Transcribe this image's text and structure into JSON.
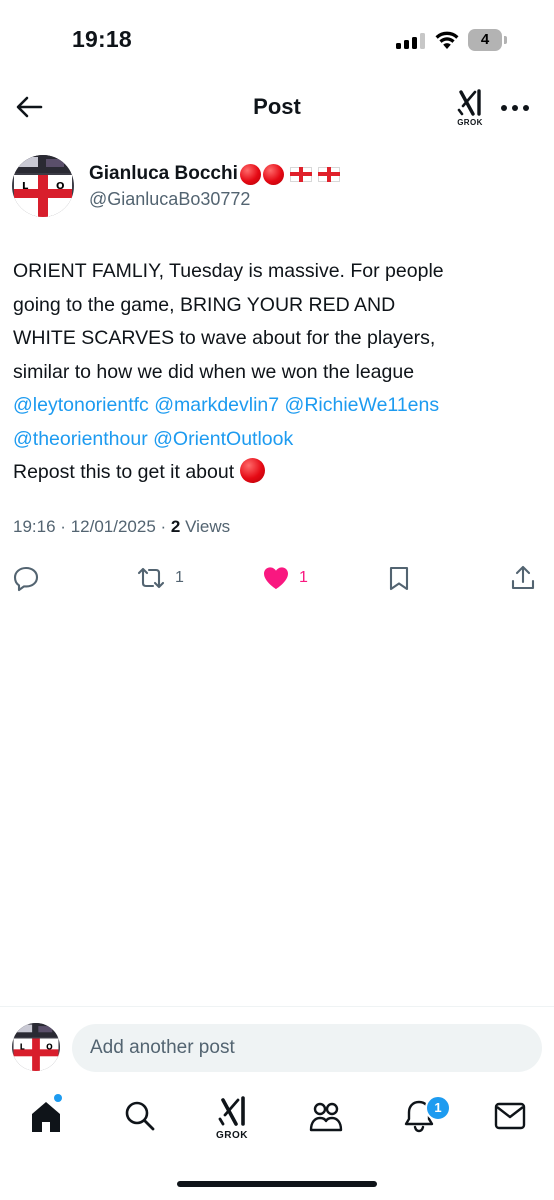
{
  "status_bar": {
    "time": "19:18",
    "battery_level": "4",
    "signal_bars_active": 3,
    "signal_bars_total": 4
  },
  "header": {
    "title": "Post",
    "grok_label": "GROK",
    "back_icon": "arrow-left-icon",
    "more_icon": "ellipsis-horizontal-icon"
  },
  "author": {
    "name": "Gianluca Bocchi",
    "handle": "@GianlucaBo30772",
    "name_emojis": [
      "red-circle",
      "red-circle",
      "england-flag",
      "england-flag"
    ]
  },
  "post": {
    "text_lines": [
      "ORIENT FAMLIY, Tuesday is massive. For people",
      "going to the game, BRING YOUR RED AND",
      "WHITE SCARVES to wave about for the players,",
      "similar to how we did when we won the league"
    ],
    "mentions_line1": [
      "@leytonorientfc",
      "@markdevlin7",
      "@RichieWe11ens"
    ],
    "mentions_line2": [
      "@theorienthour",
      "@OrientOutlook"
    ],
    "closing_text": "Repost this to get it about"
  },
  "meta": {
    "time": "19:16",
    "date": "12/01/2025",
    "views_count": "2",
    "views_label": "Views",
    "separator": "·"
  },
  "actions": {
    "reply_icon": "reply-icon",
    "repost_icon": "repost-icon",
    "repost_count": "1",
    "like_icon": "heart-icon",
    "like_count": "1",
    "liked": true,
    "bookmark_icon": "bookmark-icon",
    "share_icon": "share-icon"
  },
  "composer": {
    "placeholder": "Add another post"
  },
  "tab_bar": {
    "items": [
      "home-icon",
      "search-icon",
      "grok-icon",
      "communities-icon",
      "notifications-icon",
      "messages-icon"
    ],
    "grok_label": "GROK",
    "notifications_badge": "1"
  },
  "colors": {
    "accent": "#1d9bf0",
    "like": "#f91880",
    "text_primary": "#0f1419",
    "text_secondary": "#536471",
    "input_bg": "#eff3f4"
  }
}
